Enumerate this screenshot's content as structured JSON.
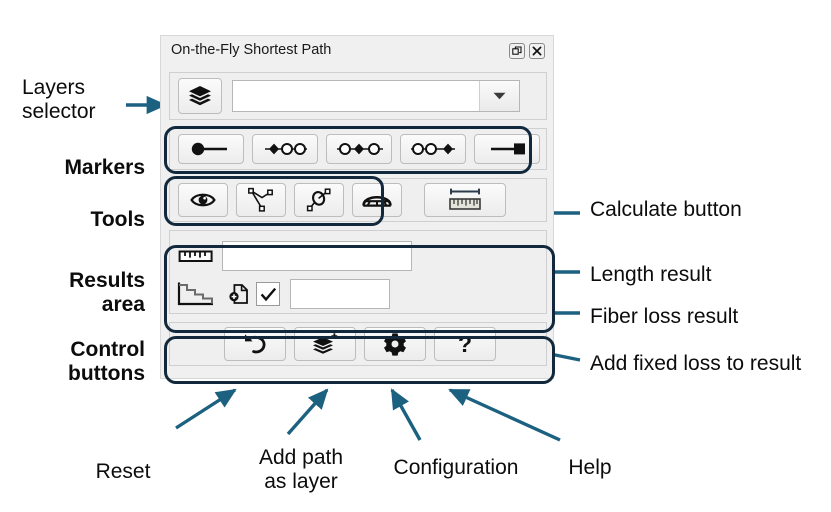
{
  "panel": {
    "title": "On-the-Fly Shortest Path",
    "titlebar_icons": [
      {
        "name": "undock-icon",
        "glyph": "❐"
      },
      {
        "name": "close-icon",
        "glyph": "✕"
      }
    ],
    "layers": {
      "button_icon": "layers-icon",
      "combo_value": "",
      "combo_placeholder": "",
      "dropdown_icon": "chevron-down-icon"
    },
    "markers": [
      {
        "name": "marker-start",
        "icon": "start-point-icon"
      },
      {
        "name": "marker-point-1",
        "icon": "waypoint-1-icon"
      },
      {
        "name": "marker-point-2",
        "icon": "waypoint-2-icon"
      },
      {
        "name": "marker-point-3",
        "icon": "waypoint-3-icon"
      },
      {
        "name": "marker-end",
        "icon": "end-point-icon"
      }
    ],
    "tools": [
      {
        "name": "tool-visibility",
        "icon": "eye-icon"
      },
      {
        "name": "tool-polyline",
        "icon": "polyline-icon"
      },
      {
        "name": "tool-loop",
        "icon": "loop-icon"
      },
      {
        "name": "tool-bridge",
        "icon": "bridge-icon"
      }
    ],
    "calculate": {
      "name": "calculate-button",
      "icon": "ruler-icon"
    },
    "results": {
      "length": {
        "icon": "ruler-icon",
        "value": ""
      },
      "fiber_loss": {
        "icon": "attenuation-chart-icon",
        "add_file_icon": "add-document-icon",
        "checkbox_checked": true,
        "value": ""
      }
    },
    "controls": [
      {
        "name": "reset-button",
        "icon": "undo-icon"
      },
      {
        "name": "add-path-layer-button",
        "icon": "add-layer-icon"
      },
      {
        "name": "configuration-button",
        "icon": "gear-icon"
      },
      {
        "name": "help-button",
        "icon": "question-mark-icon"
      }
    ]
  },
  "annotations": {
    "left": [
      {
        "name": "annotation-layers-selector",
        "text_line1": "Layers",
        "text_line2": "selector",
        "bold": false
      },
      {
        "name": "annotation-markers",
        "text_line1": "Markers",
        "text_line2": "",
        "bold": true
      },
      {
        "name": "annotation-tools",
        "text_line1": "Tools",
        "text_line2": "",
        "bold": true
      },
      {
        "name": "annotation-results-area",
        "text_line1": "Results",
        "text_line2": "area",
        "bold": true
      },
      {
        "name": "annotation-control-buttons",
        "text_line1": "Control",
        "text_line2": "buttons",
        "bold": true
      }
    ],
    "right": [
      {
        "name": "annotation-calculate-button",
        "text": "Calculate button"
      },
      {
        "name": "annotation-length-result",
        "text": "Length result"
      },
      {
        "name": "annotation-fiber-loss-result",
        "text": "Fiber loss result"
      },
      {
        "name": "annotation-add-fixed-loss",
        "text": "Add fixed loss to result"
      }
    ],
    "bottom": [
      {
        "name": "annotation-reset",
        "line1": "Reset",
        "line2": ""
      },
      {
        "name": "annotation-add-path-as-layer",
        "line1": "Add path",
        "line2": "as layer"
      },
      {
        "name": "annotation-configuration",
        "line1": "Configuration",
        "line2": ""
      },
      {
        "name": "annotation-help",
        "line1": "Help",
        "line2": ""
      }
    ]
  },
  "colors": {
    "arrow": "#1d6181",
    "highlight_box": "#12293d",
    "panel_bg": "#f0f0f0",
    "text": "#0c0c0c"
  }
}
